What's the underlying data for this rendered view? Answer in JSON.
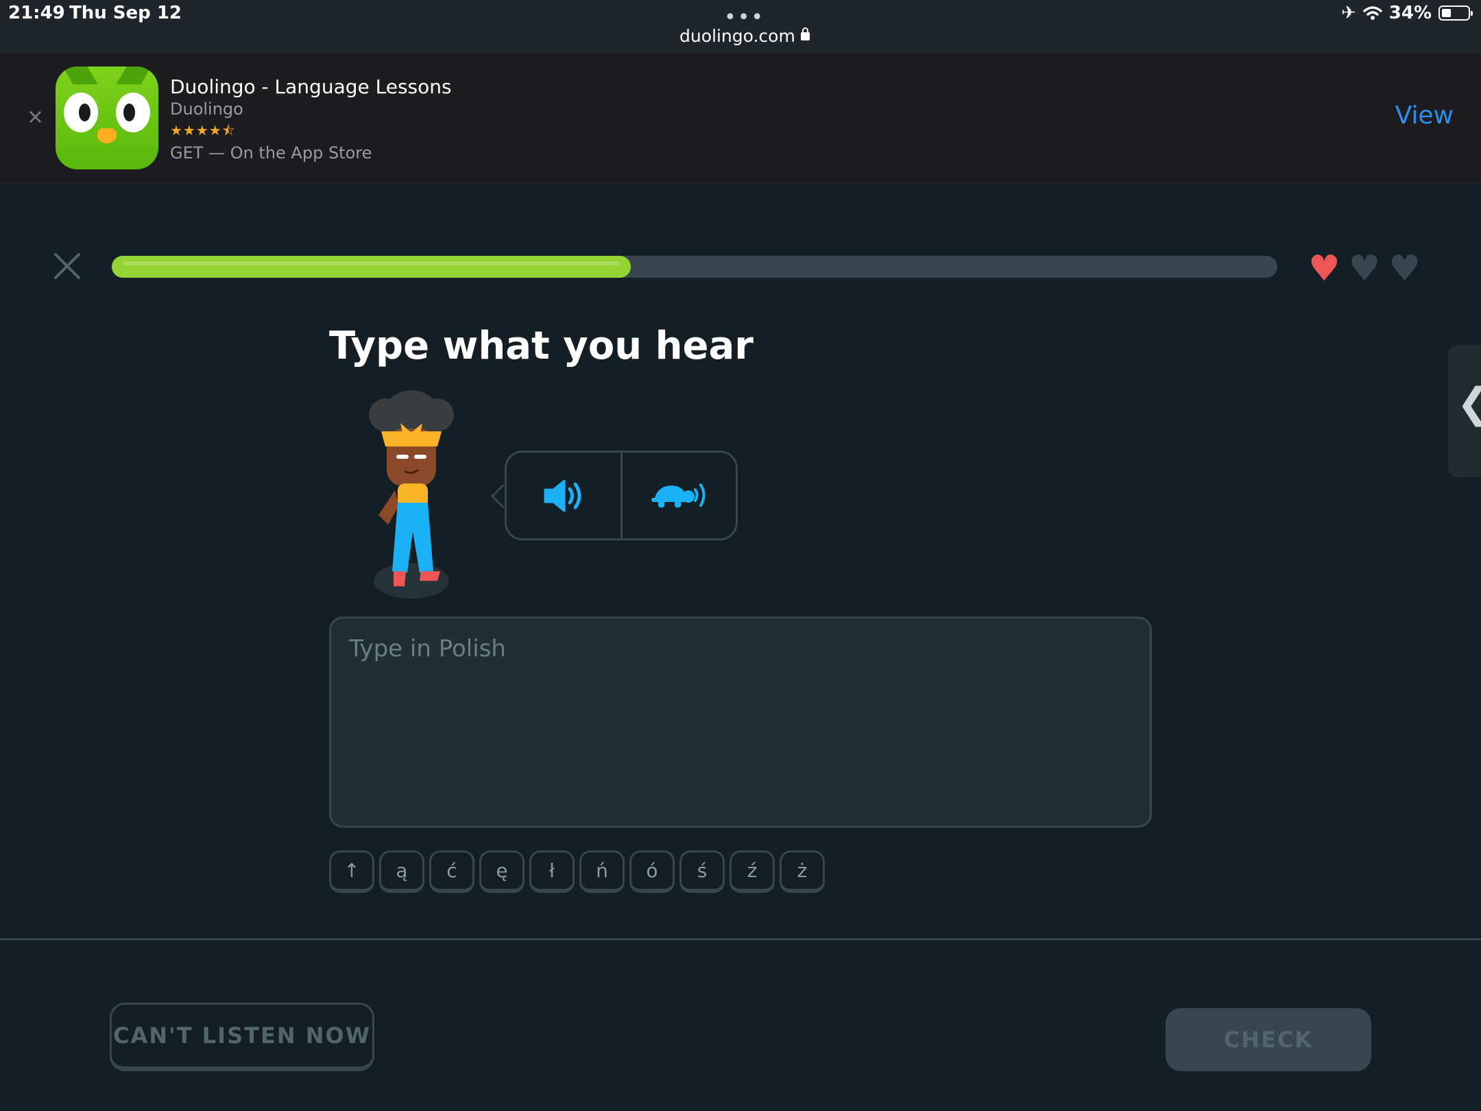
{
  "status_bar": {
    "time": "21:49",
    "date": "Thu Sep 12",
    "url": "duolingo.com",
    "battery": "34%",
    "icons": [
      "airplane-icon",
      "wifi-icon",
      "battery-icon",
      "lock-icon"
    ]
  },
  "app_banner": {
    "name": "Duolingo - Language Lessons",
    "developer": "Duolingo",
    "rating_stars": "★★★★⯪",
    "rating_value": 4.5,
    "get_text": "GET — On the App Store",
    "view_label": "View",
    "close_glyph": "×"
  },
  "lesson": {
    "progress_fraction": 0.445,
    "hearts": [
      {
        "state": "full",
        "color": "#ee5555"
      },
      {
        "state": "empty",
        "color": "#37464f"
      },
      {
        "state": "empty",
        "color": "#37464f"
      }
    ],
    "prompt": "Type what you hear",
    "audio_buttons": [
      "speaker-icon",
      "turtle-slow-icon"
    ],
    "input_placeholder": "Type in Polish",
    "input_value": "",
    "special_keys": [
      "↑",
      "ą",
      "ć",
      "ę",
      "ł",
      "ń",
      "ó",
      "ś",
      "ź",
      "ż"
    ],
    "cant_listen_label": "CAN'T LISTEN NOW",
    "check_label": "CHECK"
  },
  "colors": {
    "background": "#131f24",
    "progress_green": "#93d333",
    "accent_blue": "#1cb0f6",
    "border": "#37464f",
    "banner_link": "#2e8ff0"
  }
}
